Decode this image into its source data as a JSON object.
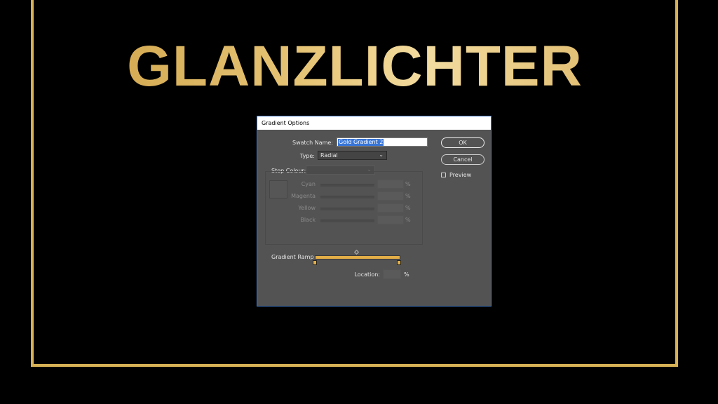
{
  "headline": "GLANZLICHTER",
  "colors": {
    "gold": "#d7b155",
    "dialog_bg": "#535353",
    "selection": "#3875d7",
    "ramp": "#e2ae47"
  },
  "dialog": {
    "title": "Gradient Options",
    "swatch_name_label": "Swatch Name:",
    "swatch_name_value": "Gold Gradient 2",
    "type_label": "Type:",
    "type_value": "Radial",
    "stop_colour_label": "Stop Colour:",
    "stop_colour_value": "",
    "channels": [
      {
        "label": "Cyan",
        "unit": "%"
      },
      {
        "label": "Magenta",
        "unit": "%"
      },
      {
        "label": "Yellow",
        "unit": "%"
      },
      {
        "label": "Black",
        "unit": "%"
      }
    ],
    "gradient_ramp_label": "Gradient Ramp",
    "location_label": "Location:",
    "location_unit": "%",
    "ok_label": "OK",
    "cancel_label": "Cancel",
    "preview_label": "Preview",
    "preview_checked": false
  }
}
